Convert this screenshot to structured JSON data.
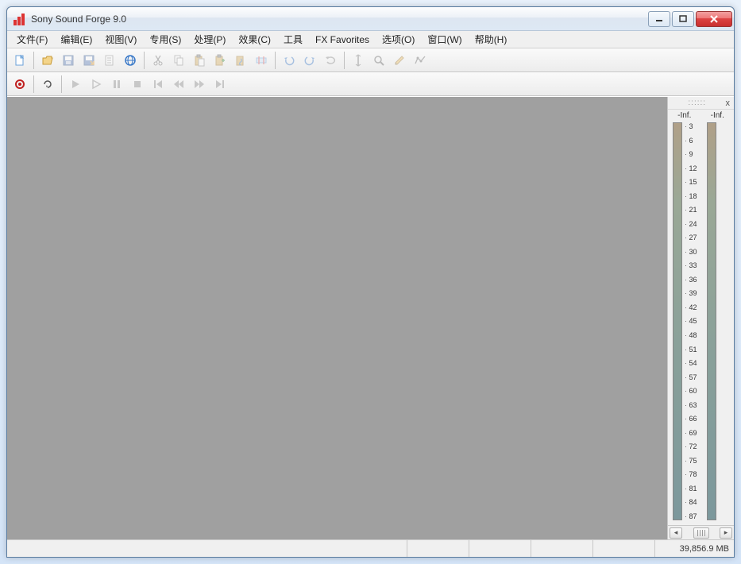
{
  "window": {
    "title": "Sony Sound Forge 9.0"
  },
  "menu": {
    "file": "文件(F)",
    "edit": "编辑(E)",
    "view": "视图(V)",
    "special": "专用(S)",
    "process": "处理(P)",
    "effects": "效果(C)",
    "tools": "工具",
    "fxfav": "FX Favorites",
    "options": "选项(O)",
    "window": "窗口(W)",
    "help": "帮助(H)"
  },
  "toolbar1": {
    "icons": [
      "new",
      "open",
      "save",
      "saveas",
      "properties",
      "web",
      "cut",
      "copy",
      "paste",
      "pastenew",
      "mix",
      "trim",
      "undo",
      "redo",
      "repeat",
      "edittool",
      "magnify",
      "pencil",
      "envelope"
    ]
  },
  "transport": {
    "icons": [
      "record",
      "loop",
      "play",
      "playall",
      "pause",
      "stop",
      "gostart",
      "rewind",
      "forward",
      "goend"
    ]
  },
  "meter": {
    "grip": "::::::",
    "close": "x",
    "left_label": "-Inf.",
    "right_label": "-Inf.",
    "scale": [
      "3",
      "6",
      "9",
      "12",
      "15",
      "18",
      "21",
      "24",
      "27",
      "30",
      "33",
      "36",
      "39",
      "42",
      "45",
      "48",
      "51",
      "54",
      "57",
      "60",
      "63",
      "66",
      "69",
      "72",
      "75",
      "78",
      "81",
      "84",
      "87"
    ]
  },
  "status": {
    "disk": "39,856.9 MB"
  }
}
